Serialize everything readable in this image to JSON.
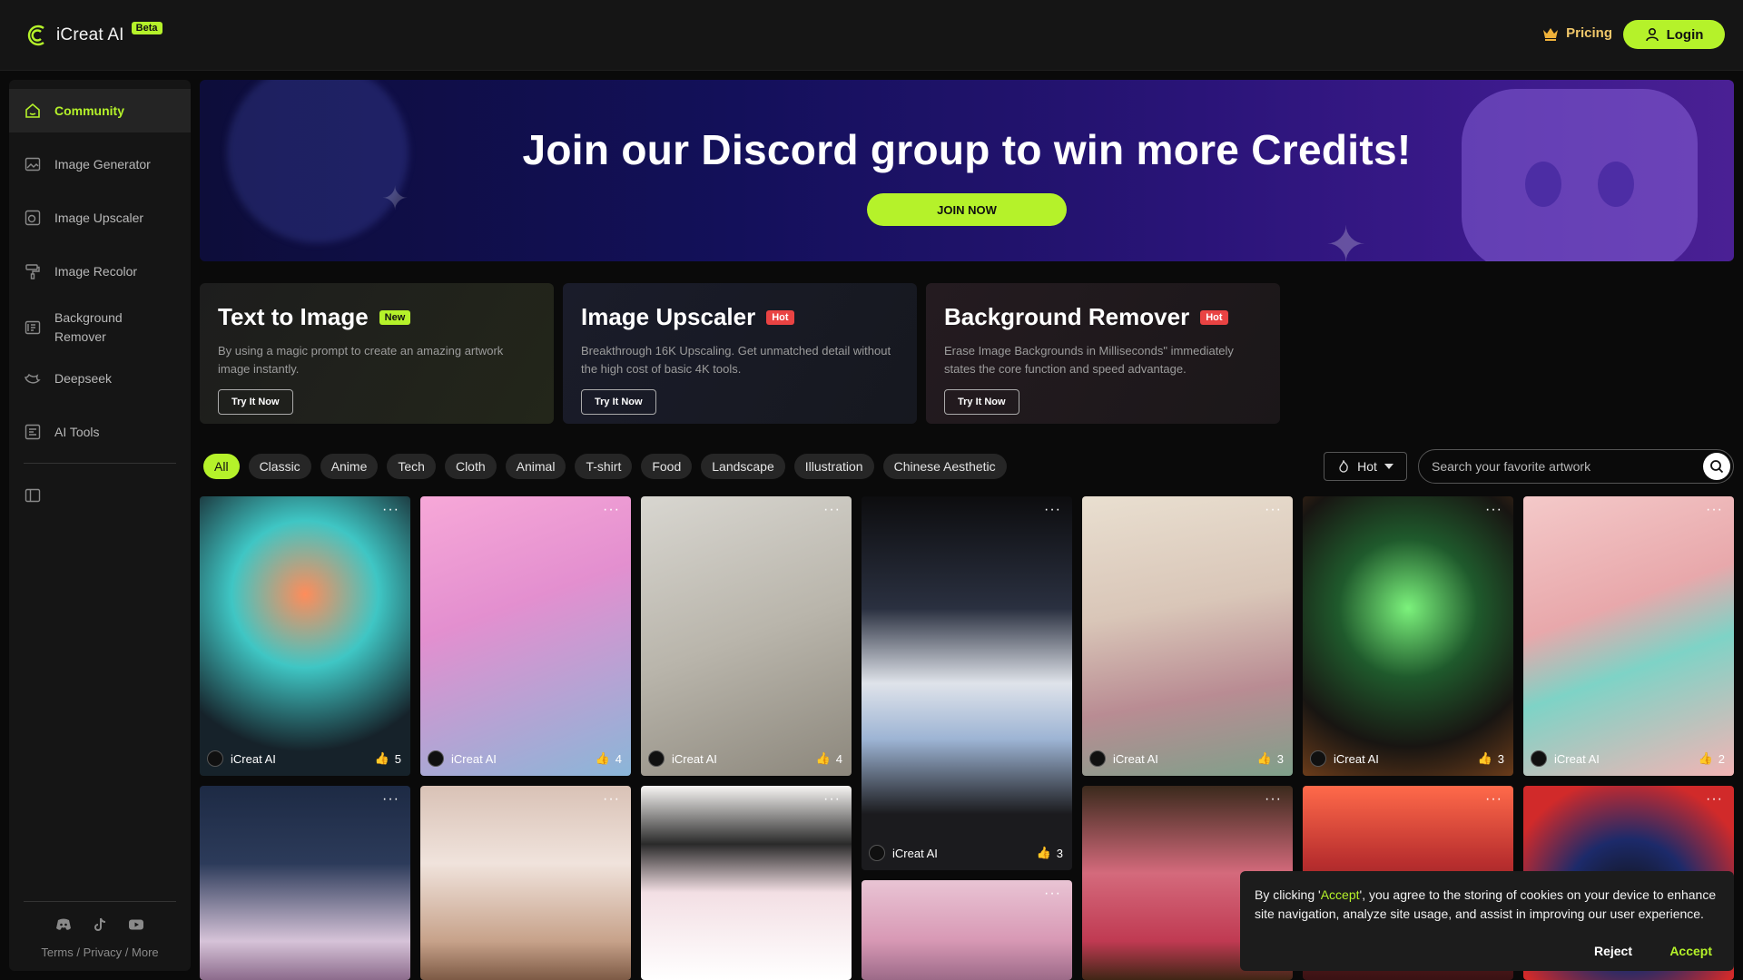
{
  "header": {
    "brand_name": "iCreat AI",
    "beta_label": "Beta",
    "pricing_label": "Pricing",
    "login_label": "Login"
  },
  "sidebar": {
    "items": [
      {
        "label": "Community",
        "icon": "home-icon",
        "active": true
      },
      {
        "label": "Image Generator",
        "icon": "image-generator-icon"
      },
      {
        "label": "Image Upscaler",
        "icon": "image-upscaler-icon"
      },
      {
        "label": "Image Recolor",
        "icon": "paint-roller-icon"
      },
      {
        "label": "Background Remover",
        "icon": "background-remover-icon"
      },
      {
        "label": "Deepseek",
        "icon": "deepseek-whale-icon"
      },
      {
        "label": "AI Tools",
        "icon": "ai-tools-icon"
      }
    ],
    "footer_links": "Terms / Privacy / More"
  },
  "banner": {
    "title": "Join our Discord group to win more Credits!",
    "button_label": "JOIN NOW"
  },
  "features": [
    {
      "title": "Text to Image",
      "tag": "New",
      "description": "By using a magic prompt to create an amazing artwork image instantly.",
      "button": "Try It Now"
    },
    {
      "title": "Image Upscaler",
      "tag": "Hot",
      "description": "Breakthrough 16K Upscaling. Get unmatched detail without the high cost of basic 4K tools.",
      "button": "Try It Now"
    },
    {
      "title": "Background Remover",
      "tag": "Hot",
      "description": "Erase Image Backgrounds in Milliseconds\" immediately states the core function and speed advantage.",
      "button": "Try It Now"
    }
  ],
  "filters": {
    "chips": [
      "All",
      "Classic",
      "Anime",
      "Tech",
      "Cloth",
      "Animal",
      "T-shirt",
      "Food",
      "Landscape",
      "Illustration",
      "Chinese Aesthetic"
    ],
    "active": "All",
    "sort_label": "Hot",
    "search_placeholder": "Search your favorite artwork"
  },
  "gallery": [
    {
      "author": "iCreat AI",
      "likes": "5"
    },
    {
      "author": "iCreat AI",
      "likes": "4"
    },
    {
      "author": "iCreat AI",
      "likes": "4"
    },
    {
      "author": "iCreat AI",
      "likes": "3"
    },
    {
      "author": "iCreat AI",
      "likes": "3"
    },
    {
      "author": "iCreat AI",
      "likes": "3"
    },
    {
      "author": "iCreat AI",
      "likes": "2"
    }
  ],
  "cookie": {
    "text_before": "By clicking '",
    "accept_word": "Accept",
    "text_after": "', you agree to the storing of cookies on your device to enhance site navigation, analyze site usage, and assist in improving our user experience.",
    "reject_label": "Reject",
    "accept_label": "Accept"
  },
  "colors": {
    "accent": "#b5f22a",
    "hot": "#e94343",
    "background": "#0a0a0a",
    "panel": "#151515"
  }
}
